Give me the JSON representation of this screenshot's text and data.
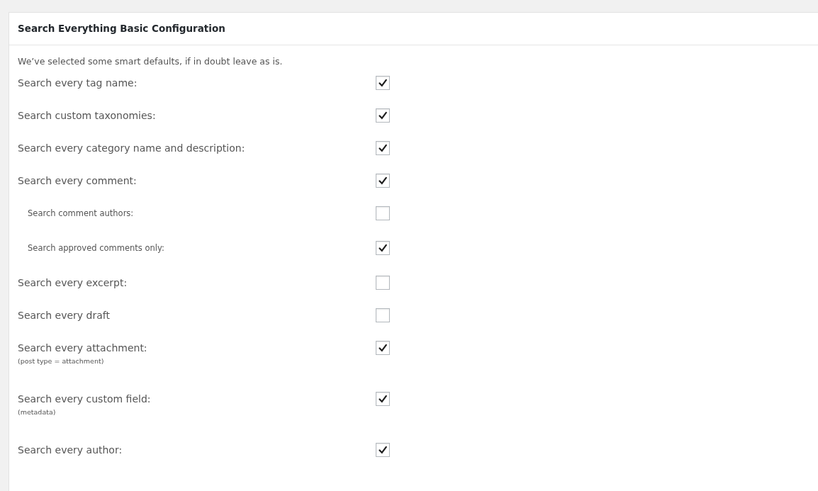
{
  "panel": {
    "title": "Search Everything Basic Configuration",
    "intro": "We’ve selected some smart defaults, if in doubt leave as is.",
    "options": [
      {
        "kind": "main",
        "label": "Search every tag name:",
        "checked": true
      },
      {
        "kind": "main",
        "label": "Search custom taxonomies:",
        "checked": true
      },
      {
        "kind": "main",
        "label": "Search every category name and description:",
        "checked": true
      },
      {
        "kind": "main",
        "label": "Search every comment:",
        "checked": true
      },
      {
        "kind": "sub",
        "label": "Search comment authors:",
        "checked": false
      },
      {
        "kind": "sub",
        "label": "Search approved comments only:",
        "checked": true
      },
      {
        "kind": "main",
        "label": "Search every excerpt:",
        "checked": false
      },
      {
        "kind": "main",
        "label": "Search every draft",
        "checked": false
      },
      {
        "kind": "main",
        "label": "Search every attachment:",
        "note": "(post type = attachment)",
        "checked": true
      },
      {
        "kind": "main",
        "label": "Search every custom field:",
        "note": "(metadata)",
        "checked": true
      },
      {
        "kind": "main",
        "label": "Search every author:",
        "checked": true
      }
    ]
  }
}
